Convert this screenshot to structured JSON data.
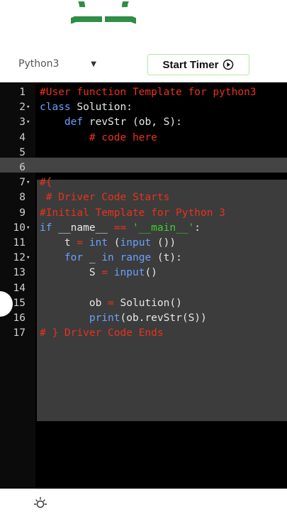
{
  "header": {
    "logo_icon": "geeksforgeeks-logo-icon",
    "brand_color": "#2f8d46"
  },
  "toolbar": {
    "language": "Python3",
    "timer_label": "Start Timer",
    "timer_icon": "play-circle-icon"
  },
  "editor": {
    "lines": [
      {
        "n": "1",
        "fold": "",
        "t": "#User function Template for python3"
      },
      {
        "n": "2",
        "fold": "▾",
        "t": "class Solution:"
      },
      {
        "n": "3",
        "fold": "▾",
        "t": "    def revStr (ob, S):"
      },
      {
        "n": "4",
        "fold": "",
        "t": "        # code here"
      },
      {
        "n": "5",
        "fold": "",
        "t": ""
      },
      {
        "n": "6",
        "fold": "",
        "t": ""
      },
      {
        "n": "7",
        "fold": "▾",
        "t": "#{"
      },
      {
        "n": "8",
        "fold": "",
        "t": " # Driver Code Starts"
      },
      {
        "n": "9",
        "fold": "",
        "t": "#Initial Template for Python 3"
      },
      {
        "n": "10",
        "fold": "▾",
        "t": "if __name__ == '__main__':"
      },
      {
        "n": "11",
        "fold": "",
        "t": "    t = int (input ())"
      },
      {
        "n": "12",
        "fold": "▾",
        "t": "    for _ in range (t):"
      },
      {
        "n": "13",
        "fold": "",
        "t": "        S = input()"
      },
      {
        "n": "14",
        "fold": "",
        "t": ""
      },
      {
        "n": "15",
        "fold": "",
        "t": "        ob = Solution()"
      },
      {
        "n": "16",
        "fold": "",
        "t": "        print(ob.revStr(S))"
      },
      {
        "n": "17",
        "fold": "",
        "t": "# } Driver Code Ends"
      }
    ]
  },
  "footer": {
    "theme_icon": "sun-icon"
  }
}
